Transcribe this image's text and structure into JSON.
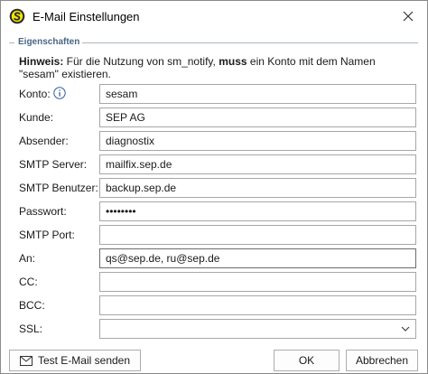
{
  "window": {
    "title": "E-Mail Einstellungen"
  },
  "group": {
    "legend": "Eigenschaften"
  },
  "hint": {
    "prefix": "Hinweis:",
    "text1": " Für die Nutzung von sm_notify, ",
    "emphasis": "muss",
    "text2": " ein Konto mit dem Namen \"sesam\" existieren."
  },
  "fields": {
    "konto": {
      "label": "Konto:",
      "value": "sesam"
    },
    "kunde": {
      "label": "Kunde:",
      "value": "SEP AG"
    },
    "absender": {
      "label": "Absender:",
      "value": "diagnostix"
    },
    "smtp_server": {
      "label": "SMTP Server:",
      "value": "mailfix.sep.de"
    },
    "smtp_benutzer": {
      "label": "SMTP Benutzer:",
      "value": "backup.sep.de"
    },
    "passwort": {
      "label": "Passwort:",
      "value": "••••••••"
    },
    "smtp_port": {
      "label": "SMTP Port:",
      "value": ""
    },
    "an": {
      "label": "An:",
      "value": "qs@sep.de, ru@sep.de"
    },
    "cc": {
      "label": "CC:",
      "value": ""
    },
    "bcc": {
      "label": "BCC:",
      "value": ""
    },
    "ssl": {
      "label": "SSL:",
      "value": ""
    }
  },
  "buttons": {
    "test_mail": "Test E-Mail senden",
    "ok": "OK",
    "cancel": "Abbrechen"
  },
  "icons": {
    "app": "sesam-logo-icon",
    "close": "close-icon",
    "info": "info-icon",
    "chevron": "chevron-down-icon",
    "mail": "envelope-icon"
  },
  "colors": {
    "legend": "#4a6584",
    "logo_ring": "#2b2b2b",
    "logo_fill": "#f2e600"
  }
}
